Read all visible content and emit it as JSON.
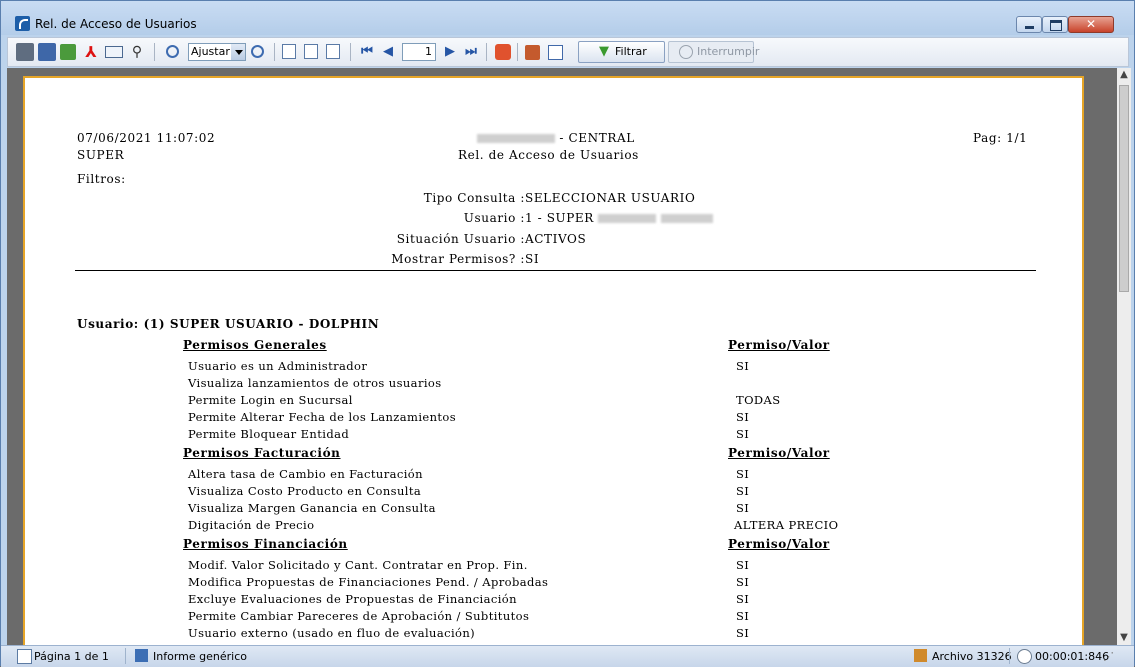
{
  "window": {
    "title": "Rel. de Acceso de Usuarios"
  },
  "toolbar": {
    "icons": [
      "print-icon",
      "save-icon",
      "export-icon",
      "pdf-icon",
      "mail-icon",
      "find-icon",
      "zoom-in-icon",
      "zoom-out-icon",
      "single-page-icon",
      "two-pages-icon",
      "thumbnails-icon",
      "first-page-icon",
      "prev-page-icon",
      "next-page-icon",
      "last-page-icon",
      "stop-icon",
      "copy-icon",
      "check-icon"
    ],
    "zoom_value": "Ajustar a",
    "page_value": "1",
    "filter_label": "Filtrar",
    "stop_label": "Interrumpir"
  },
  "report": {
    "header": {
      "datetime": "07/06/2021 11:07:02",
      "user": "SUPER",
      "company_suffix": "- CENTRAL",
      "title": "Rel. de Acceso de Usuarios",
      "page": "Pag: 1/1",
      "filters_label": "Filtros:"
    },
    "filters": [
      {
        "label": "Tipo Consulta :",
        "value": "SELECCIONAR USUARIO"
      },
      {
        "label": "Usuario :",
        "value": "1 - SUPER"
      },
      {
        "label": "Situación Usuario :",
        "value": "ACTIVOS"
      },
      {
        "label": "Mostrar Permisos? :",
        "value": "SI"
      }
    ],
    "user_line": "Usuario: (1) SUPER USUARIO - DOLPHIN",
    "value_header": "Permiso/Valor",
    "sections": [
      {
        "title": "Permisos Generales",
        "rows": [
          {
            "label": "Usuario es un Administrador",
            "value": "SI"
          },
          {
            "label": "Visualiza lanzamientos de otros usuarios",
            "value": ""
          },
          {
            "label": "Permite Login en Sucursal",
            "value": "TODAS"
          },
          {
            "label": "Permite Alterar Fecha de los Lanzamientos",
            "value": "SI"
          },
          {
            "label": "Permite Bloquear Entidad",
            "value": "SI"
          }
        ]
      },
      {
        "title": "Permisos Facturación",
        "rows": [
          {
            "label": "Altera tasa de Cambio en Facturación",
            "value": "SI"
          },
          {
            "label": "Visualiza Costo Producto en Consulta",
            "value": "SI"
          },
          {
            "label": "Visualiza Margen Ganancia en Consulta",
            "value": "SI"
          },
          {
            "label": "Digitación de Precio",
            "value": "ALTERA PRECIO"
          }
        ]
      },
      {
        "title": "Permisos Financiación",
        "rows": [
          {
            "label": "Modif. Valor Solicitado y Cant. Contratar en Prop. Fin.",
            "value": "SI"
          },
          {
            "label": "Modifica Propuestas de Financiaciones Pend. / Aprobadas",
            "value": "SI"
          },
          {
            "label": "Excluye Evaluaciones de Propuestas de Financiación",
            "value": "SI"
          },
          {
            "label": "Permite Cambiar Pareceres de Aprobación / Subtitutos",
            "value": "SI"
          },
          {
            "label": "Usuario externo (usado en fluo de evaluación)",
            "value": "SI"
          }
        ]
      }
    ]
  },
  "status": {
    "page": "Página 1 de 1",
    "report_type": "Informe genérico",
    "file": "Archivo 31326",
    "elapsed": "00:00:01:846"
  }
}
